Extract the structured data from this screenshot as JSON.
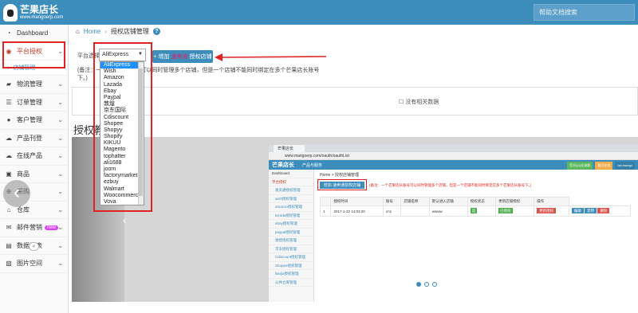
{
  "app": {
    "logo_title": "芒果店长",
    "logo_sub": "www.mangoerp.com",
    "help_search_placeholder": "帮助文档搜索"
  },
  "sidebar": {
    "items": [
      {
        "label": "Dashboard",
        "icon": "dashboard-icon"
      },
      {
        "label": "平台授权",
        "icon": "globe-icon"
      },
      {
        "label": "店铺管理",
        "icon": ""
      },
      {
        "label": "物流管理",
        "icon": "truck-icon"
      },
      {
        "label": "订单管理",
        "icon": "list-icon"
      },
      {
        "label": "客户管理",
        "icon": "user-icon"
      },
      {
        "label": "产品刊登",
        "icon": "upload-icon"
      },
      {
        "label": "在线产品",
        "icon": "cloud-icon"
      },
      {
        "label": "商品",
        "icon": "box-icon"
      },
      {
        "label": "采购",
        "icon": "cart-icon"
      },
      {
        "label": "仓库",
        "icon": "warehouse-icon"
      },
      {
        "label": "邮件营销",
        "icon": "mail-icon",
        "badge": "new"
      },
      {
        "label": "数据报表",
        "icon": "chart-icon"
      },
      {
        "label": "图片空间",
        "icon": "image-icon"
      }
    ],
    "collapse_glyph": "«"
  },
  "breadcrumb": {
    "home": "Home",
    "current": "授权店铺管理"
  },
  "form": {
    "platform_label": "平台选择",
    "platform_value": "AliExpress",
    "add_button": {
      "prefix": "+ 增加",
      "highlight": "速卖通",
      "suffix": "授权店铺"
    },
    "note": "(备注：一个芒果店长账号可以同时管理多个店铺，但是一个店铺不能同时绑定在多个芒果店长账号下。)"
  },
  "dropdown_options": [
    "AliExpress",
    "Wish",
    "Amazon",
    "Lazada",
    "Ebay",
    "Paypal",
    "敦煌",
    "京东国际",
    "Cdiscount",
    "Shopee",
    "Shopyy",
    "Shopify",
    "KIKUU",
    "Magento",
    "tophatter",
    "ali1688",
    "joom",
    "factorymarket",
    "ezbuy",
    "Walmart",
    "Woocommerce",
    "Vova"
  ],
  "empty_state": "没有相关数据",
  "tutorial_title": "授权教程",
  "tutorial_image": {
    "tab": "芒果店长",
    "url": "www.mangoerp.com/oauth/oauthList",
    "logo": "芒果店长",
    "top_menu": "产品与服务",
    "top_buttons": [
      "官方QQ交流群",
      "首页在线",
      "bai.mango"
    ],
    "side_items": [
      "Dashboard",
      "平台授权",
      "速卖通授权管理",
      "wish授权管理",
      "amazon授权管理",
      "lazada授权管理",
      "ebay授权管理",
      "paypal授权管理",
      "敦煌授权管理",
      "京东授权管理",
      "Cdiscount授权管理",
      "Shopee授权管理",
      "lianjia授权管理",
      "公共仓库管理"
    ],
    "breadcrumb": "Home > 授权店铺管理",
    "add_button": "增加 速卖通授权店铺",
    "note": "(备注：一个芒果店长账号可以同时管理多个店铺，但是一个店铺不能同时绑定在多个芒果店长账号下。)",
    "table_headers": [
      "",
      "授权时间",
      "账号",
      "店铺名称",
      "默认进入店铺",
      "授权状态",
      "更新店铺授权",
      "操作"
    ],
    "table_row": [
      "1",
      "2017-1-22 14:03:20",
      "cn1",
      "",
      "wwww",
      "是",
      "已授权",
      "更新授权"
    ],
    "row_actions": [
      "编辑",
      "禁用",
      "删除"
    ]
  },
  "colors": {
    "brand": "#3c8dbc",
    "highlight_box": "#e02424",
    "accent_text": "#e91e63"
  }
}
